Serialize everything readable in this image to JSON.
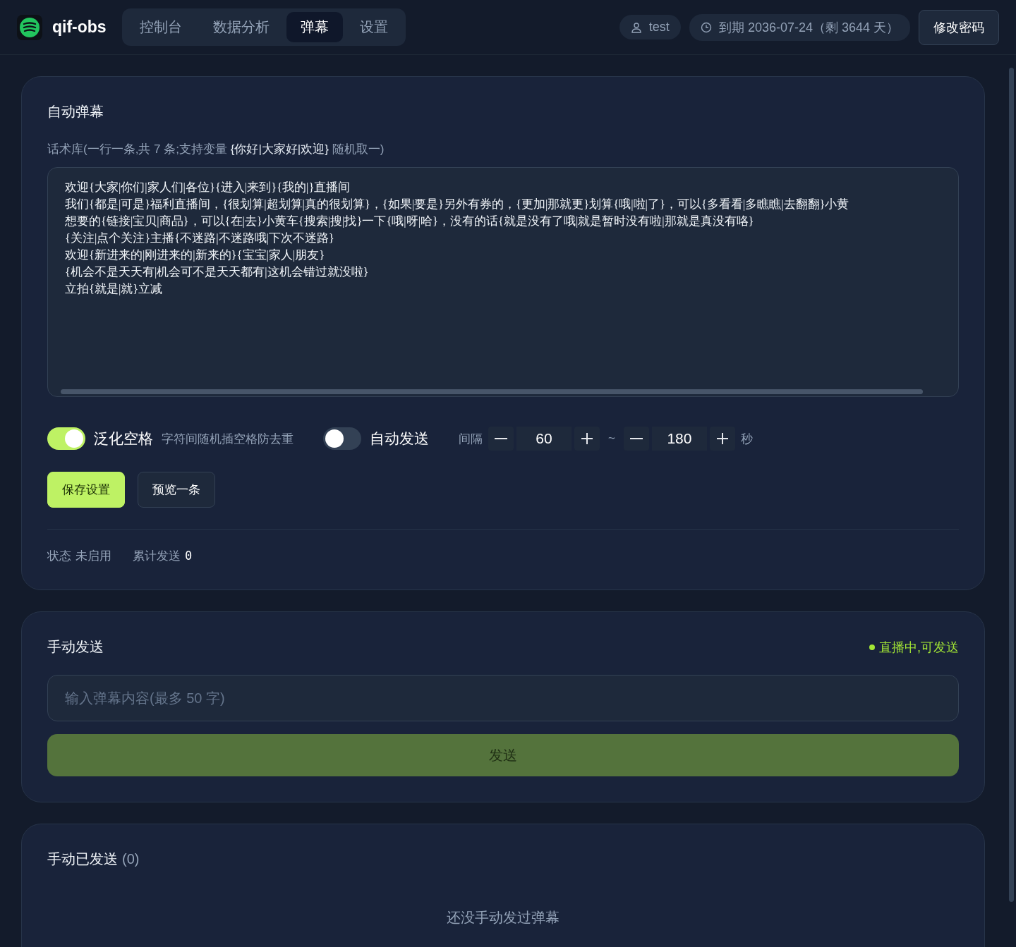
{
  "brand": {
    "name": "qif-obs"
  },
  "nav_tabs": [
    {
      "label": "控制台",
      "selected": false
    },
    {
      "label": "数据分析",
      "selected": false
    },
    {
      "label": "弹幕",
      "selected": true
    },
    {
      "label": "设置",
      "selected": false
    }
  ],
  "user": {
    "name": "test",
    "expiry": "到期 2036-07-24（剩 3644 天）"
  },
  "change_password_button": "修改密码",
  "auto_danmaku": {
    "title": "自动弹幕",
    "library_hint": "话术库(一行一条,共 7 条;支持变量 **{你好|大家好|欢迎}** 随机取一)",
    "lines": [
      "欢迎{大家|你们|家人们|各位}{进入|来到}{我的|}直播间",
      "我们{都是|可是}福利直播间，{很划算|超划算|真的很划算}，{如果|要是}另外有券的，{更加|那就更}划算{哦|啦|了}，可以{多看看|多瞧瞧|去翻翻}小黄",
      "想要的{链接|宝贝|商品}，可以{在|去}小黄车{搜索|搜|找}一下{哦|呀|哈}，没有的话{就是没有了哦|就是暂时没有啦|那就是真没有咯}",
      "{关注|点个关注}主播{不迷路|不迷路哦|下次不迷路}",
      "欢迎{新进来的|刚进来的|新来的}{宝宝|家人|朋友}",
      "{机会不是天天有|机会可不是天天都有|这机会错过就没啦}",
      "立拍{就是|就}立减"
    ],
    "toggles": [
      {
        "label": "泛化空格",
        "hint": "字符间随机插空格防去重",
        "on": true
      },
      {
        "label": "自动发送",
        "on": false
      }
    ],
    "interval": {
      "label": "间隔",
      "min": "60",
      "separator": "~",
      "max": "180",
      "unit": "秒"
    },
    "buttons": [
      {
        "label": "保存设置",
        "kind": "primary"
      },
      {
        "label": "预览一条",
        "kind": "secondary"
      }
    ],
    "status": {
      "label": "状态",
      "value": "未启用",
      "sent_label": "累计发送",
      "sent_value": "0"
    }
  },
  "manual_send": {
    "title": "手动发送",
    "live_status": {
      "text": "直播中,可发送",
      "color": "#a3e635"
    },
    "placeholder": "输入弹幕内容(最多 50 字)",
    "send_button": "发送",
    "send_disabled": true
  },
  "manual_sent": {
    "title": "手动已发送",
    "count": "(0)",
    "empty": "还没手动发过弹幕"
  }
}
